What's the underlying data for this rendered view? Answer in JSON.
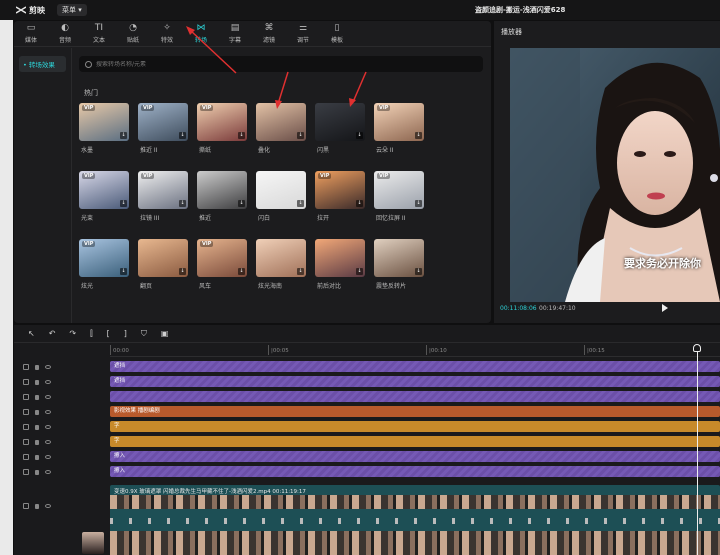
{
  "app": {
    "name": "剪映",
    "menu_label": "菜单",
    "window_title": "盗颜追剧-搬运-浅酒闪爱628"
  },
  "toolbar": {
    "items": [
      {
        "label": "媒体",
        "icon": "media-icon",
        "glyph": "▭"
      },
      {
        "label": "音频",
        "icon": "audio-icon",
        "glyph": "◐"
      },
      {
        "label": "文本",
        "icon": "text-icon",
        "glyph": "TI"
      },
      {
        "label": "贴纸",
        "icon": "sticker-icon",
        "glyph": "◔"
      },
      {
        "label": "特效",
        "icon": "effect-icon",
        "glyph": "✧"
      },
      {
        "label": "转场",
        "icon": "transition-icon",
        "glyph": "⋈",
        "active": true
      },
      {
        "label": "字幕",
        "icon": "subtitle-icon",
        "glyph": "▤"
      },
      {
        "label": "滤镜",
        "icon": "filter-icon",
        "glyph": "⌘"
      },
      {
        "label": "调节",
        "icon": "adjust-icon",
        "glyph": "⚌"
      },
      {
        "label": "模板",
        "icon": "template-icon",
        "glyph": "▯"
      }
    ]
  },
  "category": {
    "label": "• 转场效果"
  },
  "search": {
    "placeholder": "搜索转场名称/元素"
  },
  "section": {
    "title": "热门"
  },
  "transitions": [
    {
      "name": "水墨",
      "vip": true,
      "colors": [
        "#e8c9a8",
        "#5a6e82"
      ]
    },
    {
      "name": "推近 II",
      "vip": true,
      "colors": [
        "#9fb2c8",
        "#3e4c5c"
      ]
    },
    {
      "name": "撕纸",
      "vip": true,
      "colors": [
        "#f0d0b0",
        "#7a3a3a"
      ]
    },
    {
      "name": "叠化",
      "vip": false,
      "colors": [
        "#e3c2a6",
        "#6a4e48"
      ]
    },
    {
      "name": "闪黑",
      "vip": false,
      "colors": [
        "#3a3d44",
        "#141518"
      ]
    },
    {
      "name": "云朵 II",
      "vip": true,
      "colors": [
        "#f3d3b8",
        "#8d6650"
      ]
    },
    {
      "name": "光束",
      "vip": true,
      "colors": [
        "#d8d8e8",
        "#4a5a78"
      ]
    },
    {
      "name": "拉镜 III",
      "vip": true,
      "colors": [
        "#f0f0f0",
        "#6a7080"
      ]
    },
    {
      "name": "推近",
      "vip": false,
      "colors": [
        "#cccccc",
        "#3e3e40"
      ]
    },
    {
      "name": "闪白",
      "vip": false,
      "colors": [
        "#f6f6f6",
        "#d8d8d8"
      ]
    },
    {
      "name": "拉开",
      "vip": true,
      "colors": [
        "#f0a060",
        "#3a2a2a"
      ]
    },
    {
      "name": "回忆拉屏 II",
      "vip": true,
      "colors": [
        "#ececec",
        "#9aa0aa"
      ]
    },
    {
      "name": "炫光",
      "vip": true,
      "colors": [
        "#a9c4e0",
        "#3a5f7a"
      ]
    },
    {
      "name": "翻页",
      "vip": false,
      "colors": [
        "#e8b890",
        "#8a5a40"
      ]
    },
    {
      "name": "风车",
      "vip": true,
      "colors": [
        "#e6b48e",
        "#7a4a3a"
      ]
    },
    {
      "name": "炫光海南",
      "vip": false,
      "colors": [
        "#f0d0b8",
        "#a07058"
      ]
    },
    {
      "name": "前后对比",
      "vip": false,
      "colors": [
        "#f2a878",
        "#5a3a44"
      ]
    },
    {
      "name": "震垫反转片",
      "vip": false,
      "colors": [
        "#e0d0c0",
        "#6a5040"
      ]
    }
  ],
  "player": {
    "title": "播放器",
    "subtitle": "要求务必开除你",
    "current_time": "00:11:08:06",
    "total_time": "00:19:47:10"
  },
  "timeline": {
    "toolbar_icons": [
      "select-icon",
      "undo-icon",
      "redo-icon",
      "split-icon",
      "split-left-icon",
      "split-right-icon",
      "shield-icon",
      "image-icon"
    ],
    "ruler": [
      "00:00",
      "|00:05",
      "|00:10",
      "|00:15"
    ],
    "tracks": [
      {
        "label": "遮挡",
        "type": "purple"
      },
      {
        "label": "遮挡",
        "type": "purple"
      },
      {
        "label": "",
        "type": "purple"
      },
      {
        "label": "影视效果 播剧编剧",
        "type": "redorange"
      },
      {
        "label": "字",
        "type": "orange"
      },
      {
        "label": "字",
        "type": "orange"
      },
      {
        "label": "擦入",
        "type": "purple"
      },
      {
        "label": "擦入",
        "type": "purple"
      }
    ],
    "main_clip": "变速0.9X  玻璃遮罩  闪婚总裁先生马甲藏不住了-浅酒闪爱2.mp4  00:11:19:17"
  }
}
